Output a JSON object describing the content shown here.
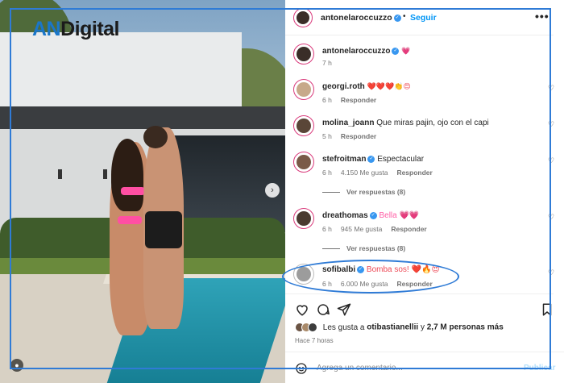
{
  "watermark": {
    "part1": "AN",
    "part2": "Digital"
  },
  "post": {
    "author": "antonelaroccuzzo",
    "separator": "•",
    "follow_label": "Seguir",
    "more_label": "•••",
    "carousel_next_label": "›",
    "tag_label": "●"
  },
  "caption": {
    "user": "antonelaroccuzzo",
    "text": "💗",
    "time": "7 h"
  },
  "comments": [
    {
      "user": "georgi.roth",
      "verified": false,
      "text": "❤️❤️❤️👏😍",
      "time": "6 h",
      "likes": "",
      "reply": "Responder",
      "view_replies": ""
    },
    {
      "user": "molina_joann",
      "verified": false,
      "text": "Que miras pajin, ojo con el capi",
      "time": "5 h",
      "likes": "",
      "reply": "Responder",
      "view_replies": ""
    },
    {
      "user": "stefroitman",
      "verified": true,
      "text": "Espectacular",
      "time": "6 h",
      "likes": "4.150 Me gusta",
      "reply": "Responder",
      "view_replies": "Ver respuestas (8)"
    },
    {
      "user": "dreathomas",
      "verified": true,
      "text": "Bella 💗💗",
      "time": "6 h",
      "likes": "945 Me gusta",
      "reply": "Responder",
      "view_replies": "Ver respuestas (8)"
    },
    {
      "user": "sofibalbi",
      "verified": true,
      "text": "Bomba sos! ❤️🔥😍",
      "time": "6 h",
      "likes": "6.000 Me gusta",
      "reply": "Responder",
      "view_replies": ""
    }
  ],
  "likes_summary": {
    "prefix": "Les gusta a ",
    "user": "otibastianellii",
    "middle": " y ",
    "count": "2,7 M personas más"
  },
  "post_time": "Hace 7 horas",
  "comment_box": {
    "placeholder": "Agrega un comentario...",
    "publish_label": "Publicar"
  },
  "icons": [
    "heart-icon",
    "comment-icon",
    "share-icon",
    "bookmark-icon",
    "emoji-icon",
    "verified-icon",
    "more-icon",
    "chevron-right-icon",
    "user-tag-icon"
  ],
  "colors": {
    "follow": "#0095f6",
    "verified": "#3897f0",
    "highlight": "#2f7bd6",
    "watermark_accent": "#1a76c9"
  }
}
